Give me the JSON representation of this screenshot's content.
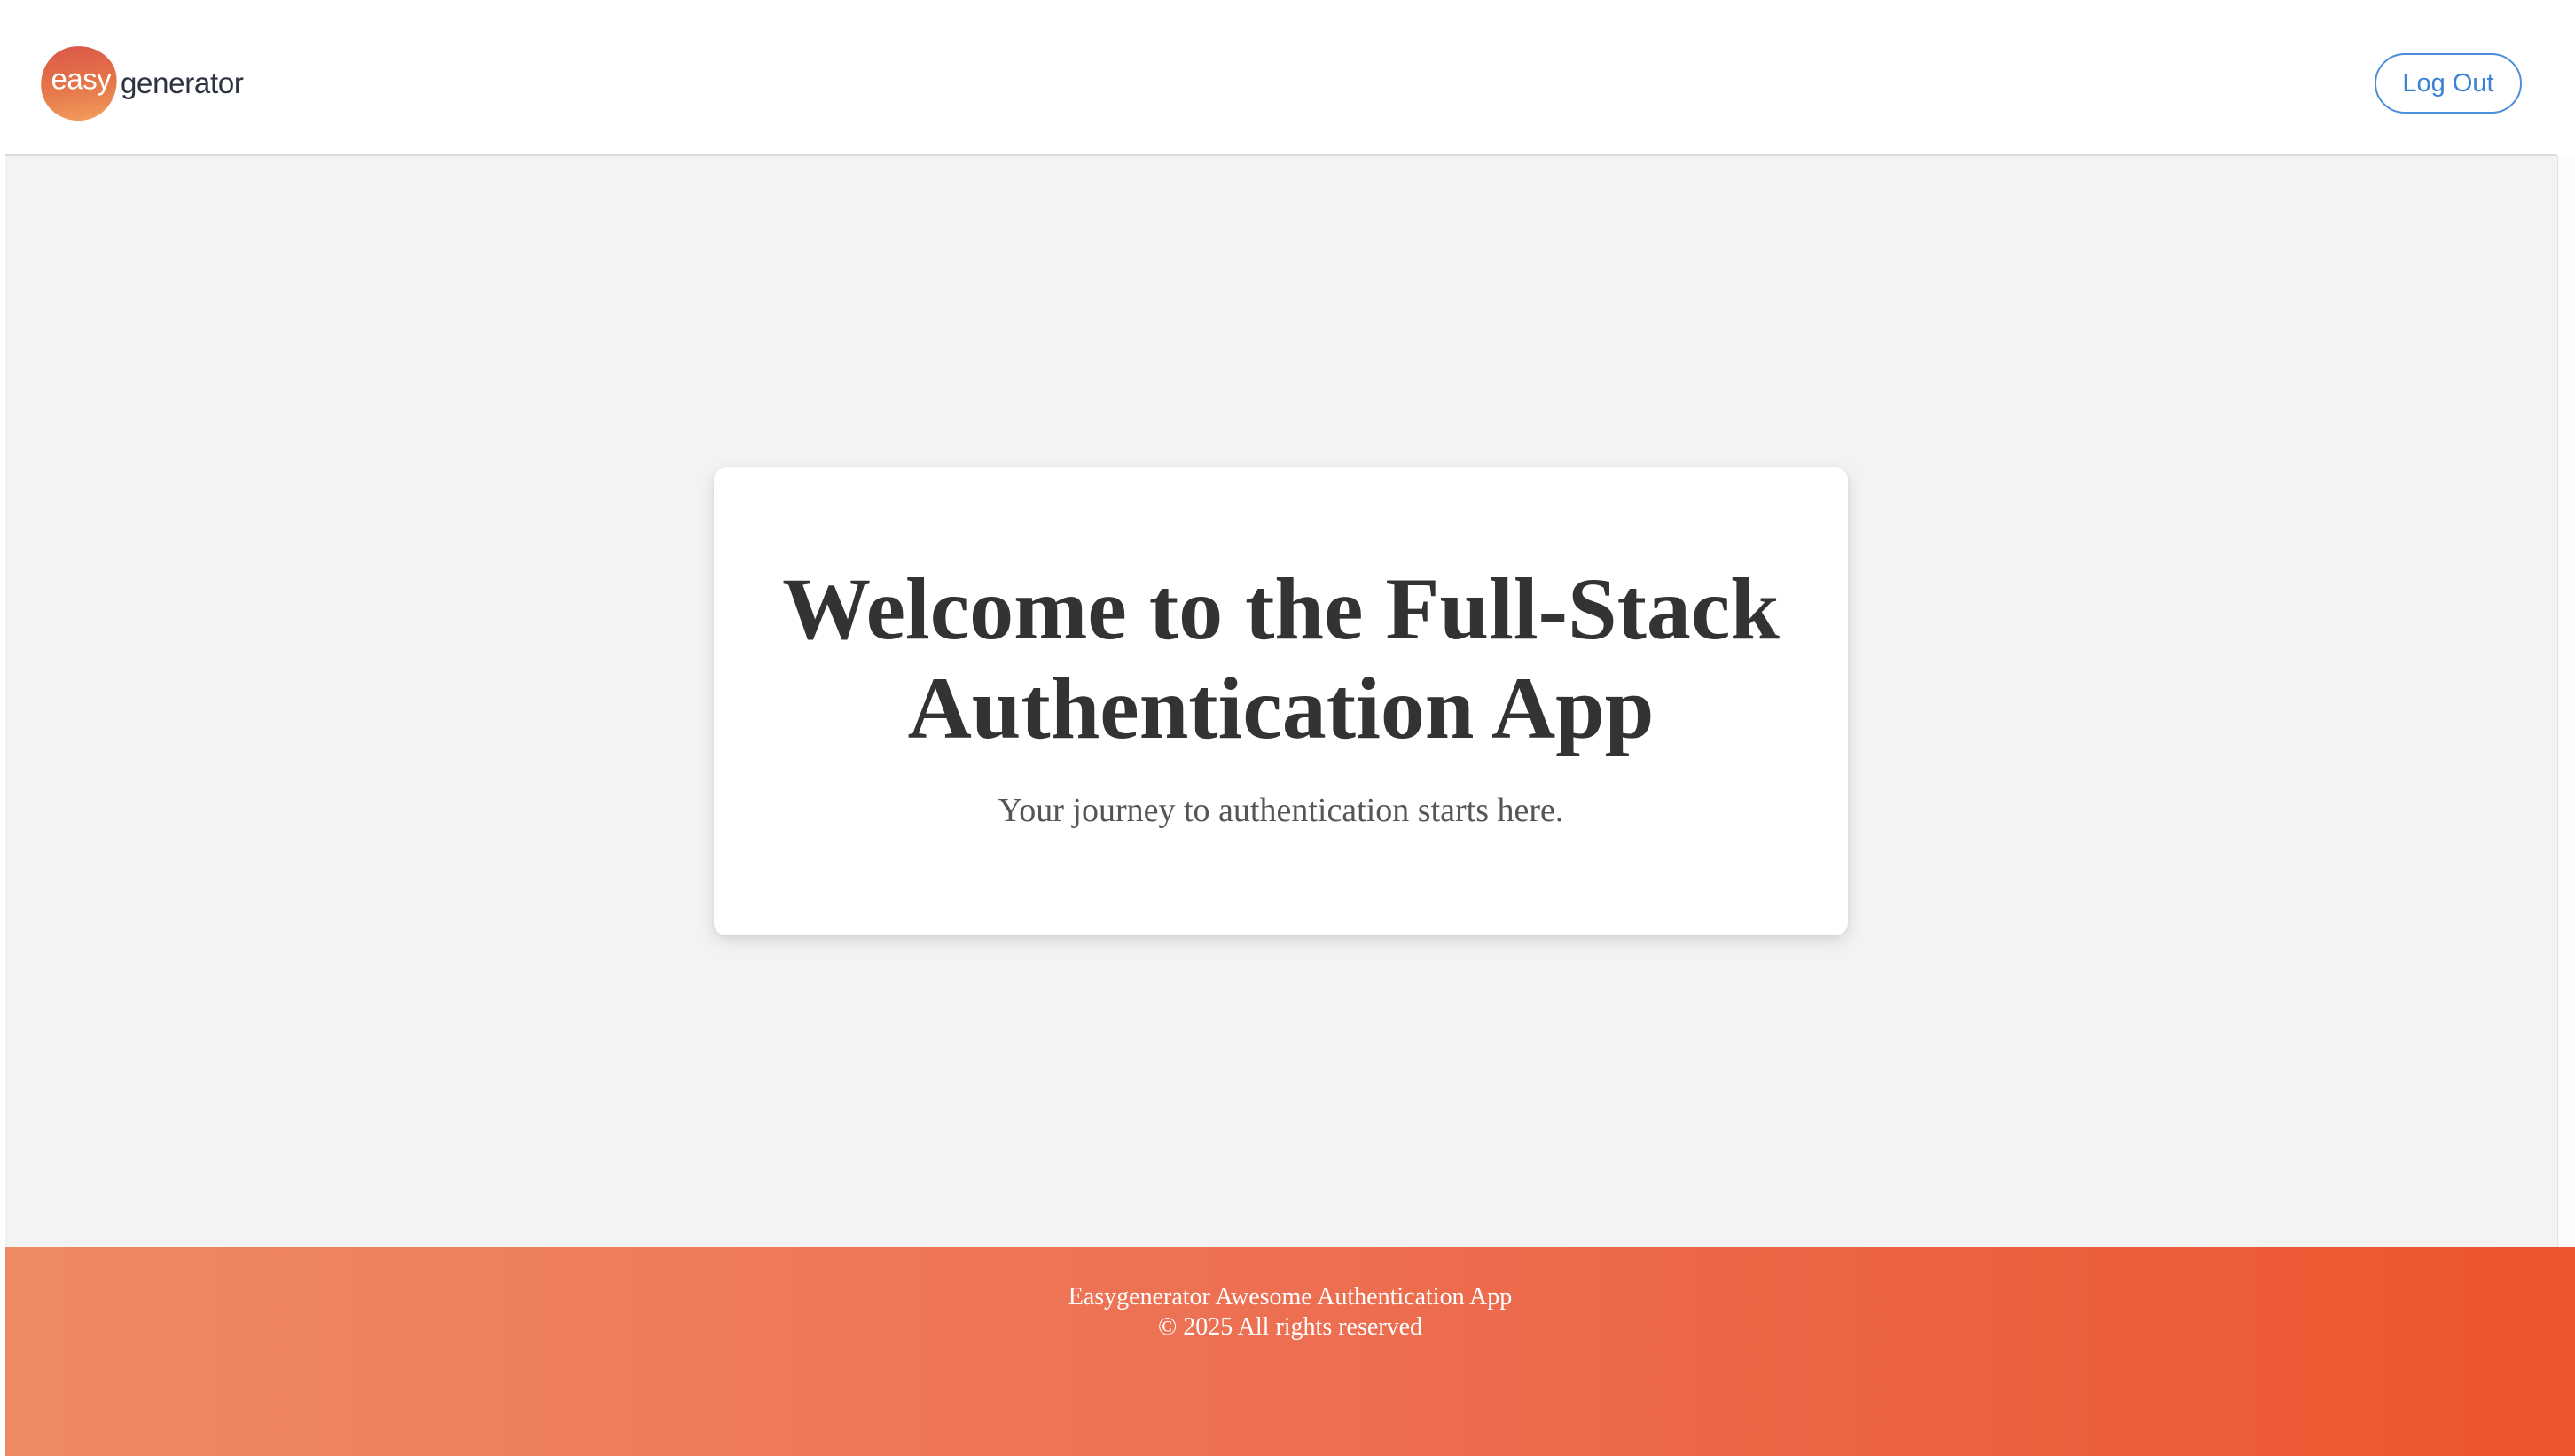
{
  "header": {
    "logo": {
      "word_easy": "easy",
      "word_generator": "generator"
    },
    "logout_label": "Log Out"
  },
  "main": {
    "card": {
      "title": "Welcome to the Full-Stack Authentication App",
      "subtitle": "Your journey to authentication starts here."
    }
  },
  "footer": {
    "app_name": "Easygenerator Awesome Authentication App",
    "copyright": "© 2025 All rights reserved"
  },
  "colors": {
    "accent_blue": "#3b82d6",
    "footer_gradient_start": "#ef8a62",
    "footer_gradient_end": "#ec552d",
    "background": "#f3f3f3"
  }
}
